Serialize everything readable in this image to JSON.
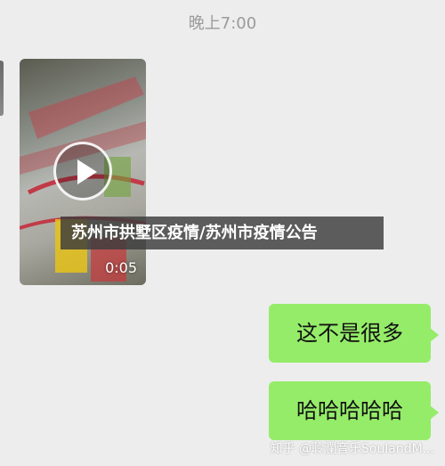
{
  "chat": {
    "timestamp": "晚上7:00",
    "video": {
      "duration": "0:05",
      "play_icon": "play-icon"
    },
    "banner_text": "苏州市拱墅区疫情/苏州市疫情公告",
    "messages": [
      {
        "text": "这不是很多",
        "side": "right"
      },
      {
        "text": "哈哈哈哈哈",
        "side": "right"
      }
    ],
    "watermark": "知乎 @聆瀾音乐SoulandM..."
  },
  "colors": {
    "background": "#ededed",
    "bubble_green": "#95ec69"
  }
}
